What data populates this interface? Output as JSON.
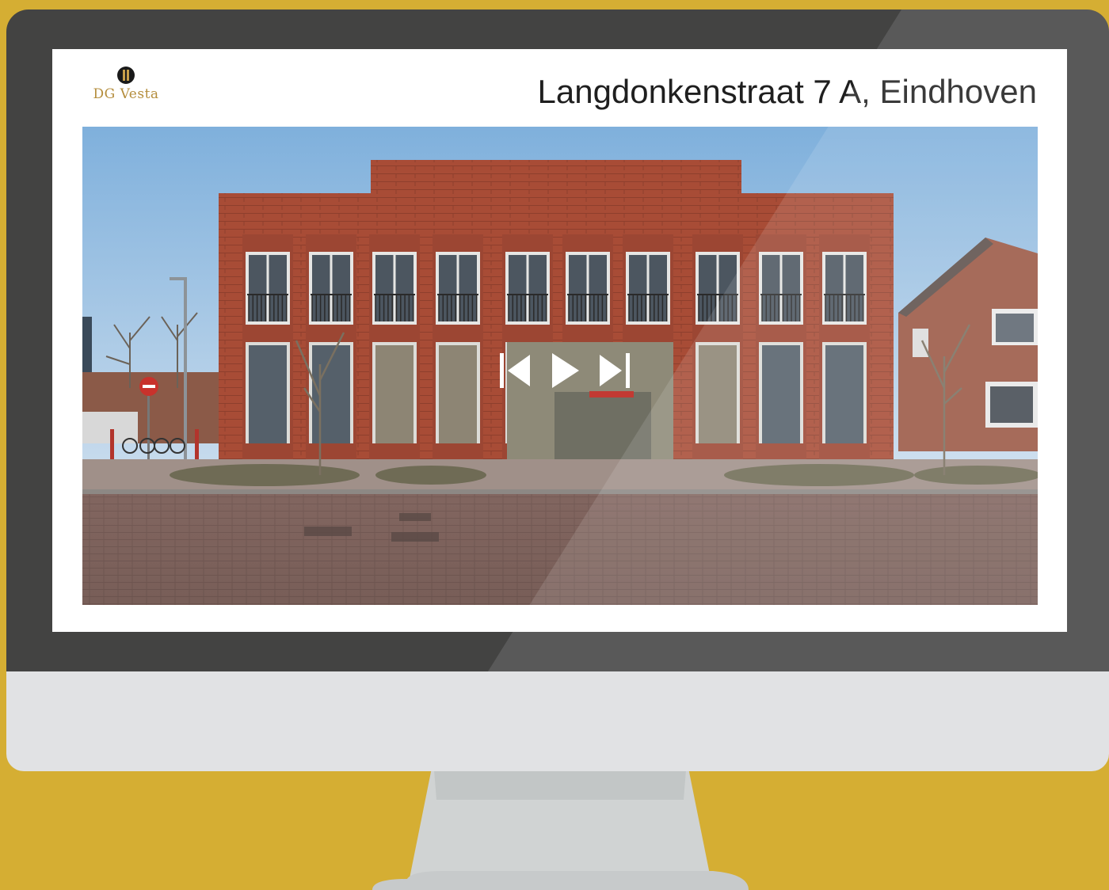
{
  "brand": {
    "name": "DG Vesta"
  },
  "listing": {
    "address": "Langdonkenstraat 7 A, Eindhoven"
  },
  "player": {
    "prev_icon": "skip-previous-icon",
    "play_icon": "play-icon",
    "next_icon": "skip-next-icon"
  },
  "colors": {
    "background": "#d5ae33",
    "bezel": "#434342",
    "chin": "#e1e2e4",
    "brand_gold": "#b48d3c",
    "brick": "#a44a36"
  }
}
